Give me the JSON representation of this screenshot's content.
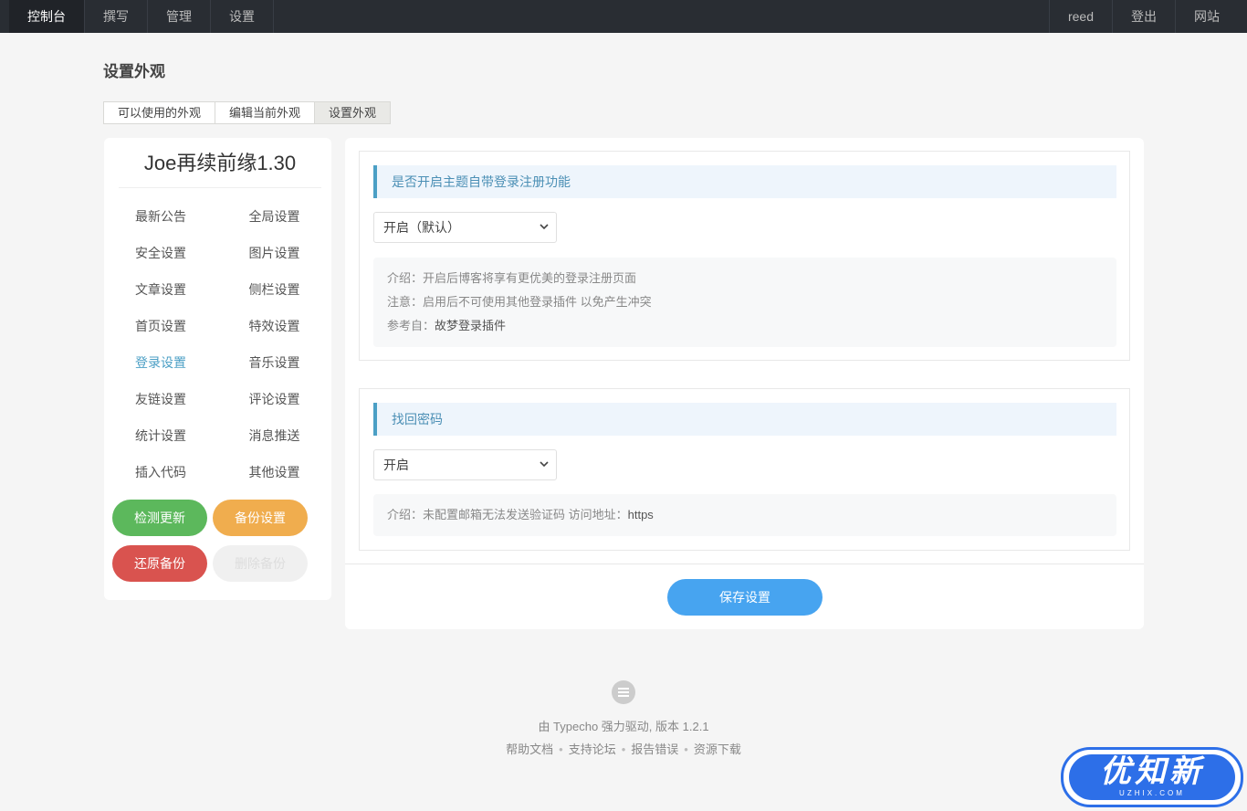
{
  "nav": {
    "left": [
      "控制台",
      "撰写",
      "管理",
      "设置"
    ],
    "right": [
      "reed",
      "登出",
      "网站"
    ]
  },
  "page_title": "设置外观",
  "tabs": [
    "可以使用的外观",
    "编辑当前外观",
    "设置外观"
  ],
  "theme": {
    "title": "Joe再续前缘1.30",
    "menu": [
      "最新公告",
      "全局设置",
      "安全设置",
      "图片设置",
      "文章设置",
      "侧栏设置",
      "首页设置",
      "特效设置",
      "登录设置",
      "音乐设置",
      "友链设置",
      "评论设置",
      "统计设置",
      "消息推送",
      "插入代码",
      "其他设置"
    ],
    "active_menu": "登录设置",
    "buttons": {
      "check_update": "检测更新",
      "backup": "备份设置",
      "restore": "还原备份",
      "delete_backup": "删除备份"
    }
  },
  "sections": [
    {
      "heading": "是否开启主题自带登录注册功能",
      "select_value": "开启（默认）",
      "notes": {
        "intro": "介绍：开启后博客将享有更优美的登录注册页面",
        "warning": "注意：启用后不可使用其他登录插件 以免产生冲突",
        "ref_prefix": "参考自：",
        "ref_link": "故梦登录插件"
      }
    },
    {
      "heading": "找回密码",
      "select_value": "开启",
      "notes": {
        "intro": "介绍：未配置邮箱无法发送验证码 访问地址：",
        "intro_strong": "https"
      }
    }
  ],
  "save_label": "保存设置",
  "footer": {
    "powered": "由 Typecho 强力驱动, 版本 1.2.1",
    "links": [
      "帮助文档",
      "支持论坛",
      "报告错误",
      "资源下载"
    ]
  },
  "watermark": {
    "text": "优知新",
    "sub": "UZHIX.COM"
  },
  "colors": {
    "accent": "#4b9fc5",
    "save": "#47a4f0",
    "green": "#5cb85c",
    "orange": "#f0ad4e",
    "red": "#d9534f"
  }
}
